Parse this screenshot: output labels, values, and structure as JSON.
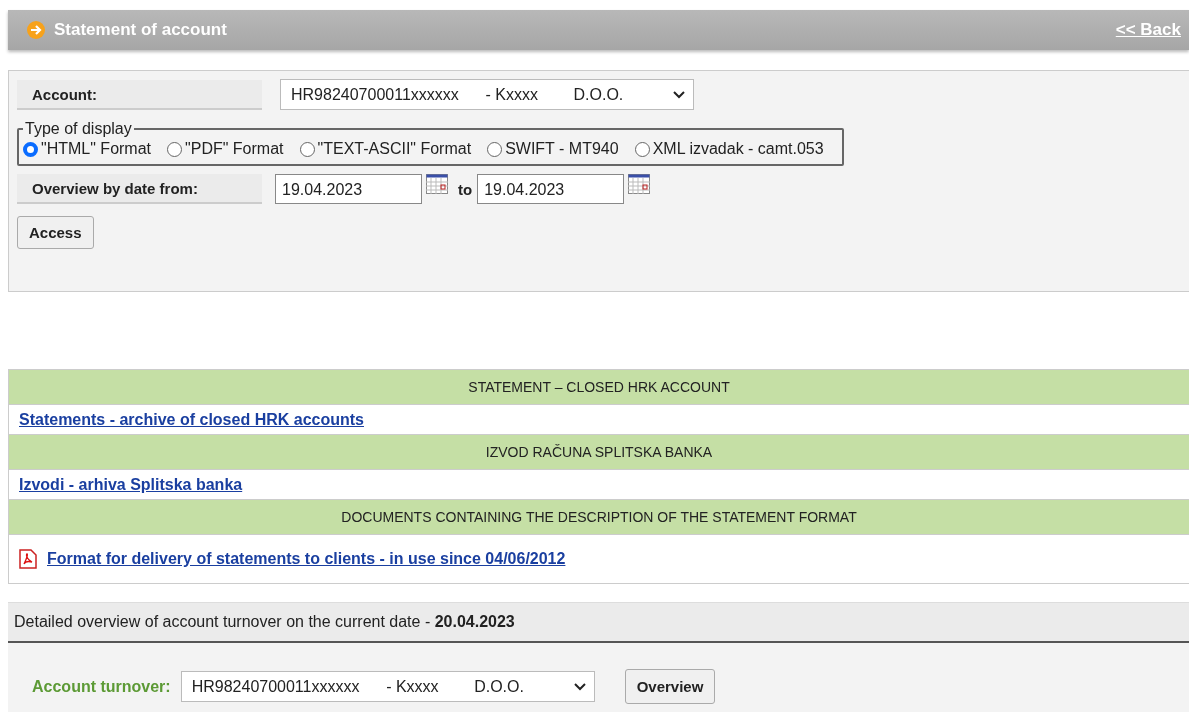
{
  "header": {
    "title": "Statement of account",
    "back_link": "<< Back"
  },
  "form": {
    "account_label": "Account:",
    "account_value": "HR98240700011xxxxxx      - Kxxxx        D.O.O.",
    "display_legend": "Type of display",
    "formats": [
      {
        "label": "\"HTML\" Format",
        "selected": true
      },
      {
        "label": "\"PDF\" Format",
        "selected": false
      },
      {
        "label": "\"TEXT-ASCII\" Format",
        "selected": false
      },
      {
        "label": "SWIFT - MT940",
        "selected": false
      },
      {
        "label": "XML izvadak - camt.053",
        "selected": false
      }
    ],
    "date_label": "Overview by date from:",
    "date_from": "19.04.2023",
    "to_label": "to",
    "date_to": "19.04.2023",
    "access_button": "Access"
  },
  "sections": [
    {
      "heading": "STATEMENT – CLOSED HRK ACCOUNT",
      "link": "Statements - archive of closed HRK accounts",
      "pdf": false
    },
    {
      "heading": "IZVOD RAČUNA SPLITSKA BANKA",
      "link": "Izvodi - arhiva Splitska banka",
      "pdf": false
    },
    {
      "heading": "DOCUMENTS CONTAINING THE DESCRIPTION OF THE STATEMENT FORMAT",
      "link": "Format for delivery of statements to clients - in use since 04/06/2012",
      "pdf": true
    }
  ],
  "turnover": {
    "heading": "Detailed overview of account turnover on the current date - **20.04.2023**",
    "label": "Account turnover:",
    "account_value": "HR98240700011xxxxxx      - Kxxxx        D.O.O.",
    "overview_button": "Overview"
  }
}
